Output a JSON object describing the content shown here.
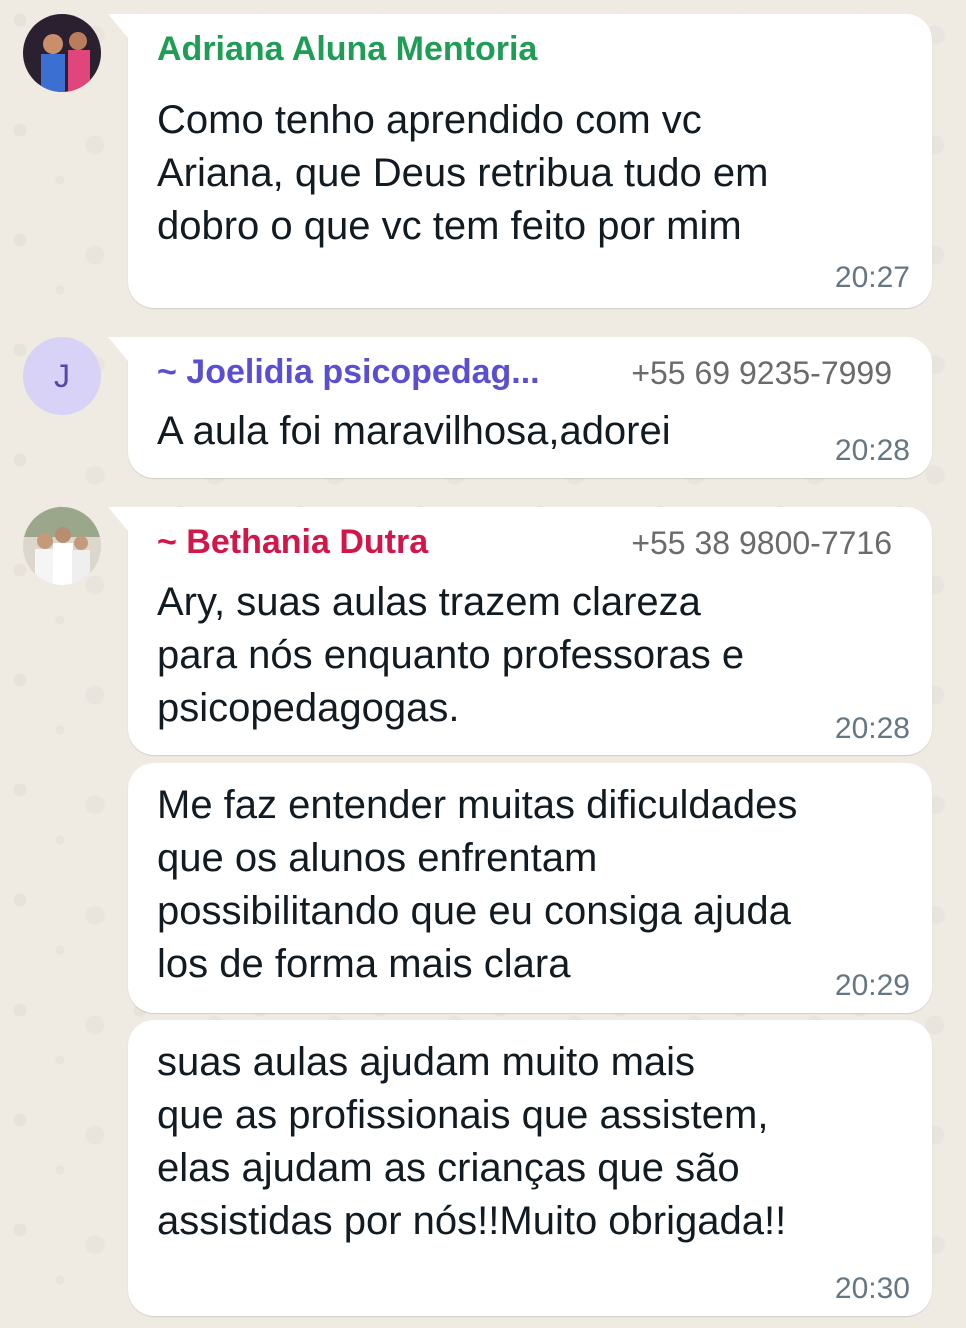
{
  "theme": {
    "chat_background": "#efeae2",
    "bubble_background": "#ffffff",
    "timestamp_color": "#667781"
  },
  "messages": [
    {
      "sender": "Adriana Aluna Mentoria",
      "sender_color": "#1f9d55",
      "phone": "",
      "text": "Como tenho aprendido com vc\nAriana, que Deus retribua tudo em\ndobro o que vc tem feito por mim",
      "time": "20:27"
    },
    {
      "sender": "~ Joelidia psicopedag...",
      "sender_color": "#5b4fd1",
      "phone": "+55 69 9235-7999",
      "avatar_letter": "J",
      "text": "A aula foi maravilhosa,adorei",
      "time": "20:28"
    },
    {
      "sender": "~ Bethania Dutra",
      "sender_color": "#d3164a",
      "phone": "+55 38 9800-7716",
      "text": "Ary, suas aulas trazem clareza\npara nós enquanto professoras e\npsicopedagogas.",
      "time": "20:28"
    },
    {
      "text": "Me faz entender muitas dificuldades\nque os alunos enfrentam\npossibilitando que eu consiga ajuda\nlos de forma mais clara",
      "time": "20:29"
    },
    {
      "text": "suas aulas ajudam muito mais\nque as profissionais que assistem,\nelas ajudam as crianças que são\nassistidas por nós!!Muito obrigada!!",
      "time": "20:30"
    }
  ]
}
